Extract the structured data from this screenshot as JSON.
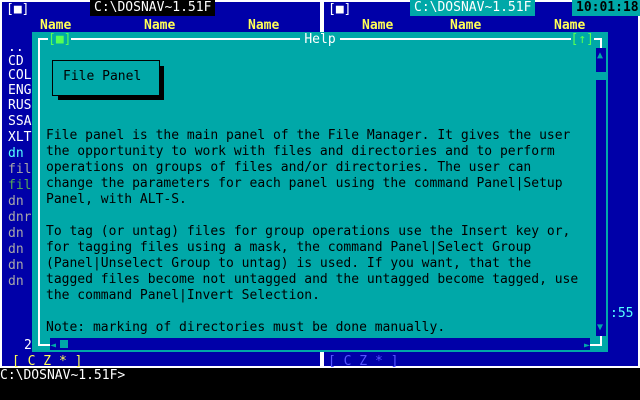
{
  "left_panel": {
    "path": "",
    "columns": [
      "Name",
      "Name",
      "Name"
    ],
    "items": [
      "..",
      "CD",
      "COL",
      "ENG",
      "RUS",
      "SSA",
      "XLT",
      "dn",
      "fil",
      "fil",
      "dn",
      "dnr",
      "dn",
      "dn",
      "dn",
      "dn"
    ],
    "drive_bar": "[ C Z * ]",
    "left_marker": "2"
  },
  "right_panel": {
    "path": "C:\\DOSNAV~1.51F",
    "columns": [
      "Name",
      "Name",
      "Name"
    ],
    "drive_bar": "[ C Z * ]",
    "edge_text": ":55"
  },
  "header": {
    "left_path": "C:\\DOSNAV~1.51F",
    "clock": "10:01:18",
    "left_close": "[■]",
    "right_close": "[■]"
  },
  "help": {
    "title": "Help",
    "close_btn": "[■]",
    "zoom_btn": "[↑]",
    "topic": "File Panel",
    "body": "File panel is the main panel of the File Manager. It gives the user\nthe opportunity to work with files and directories and to perform\noperations on groups of files and/or directories. The user can\nchange the parameters for each panel using the command Panel|Setup\nPanel, with ALT-S.\n\nTo tag (or untag) files for group operations use the Insert key or,\nfor tagging files using a mask, the command Panel|Select Group\n(Panel|Unselect Group to untag) is used. If you want, that the\ntagged files become not untagged and the untagged become tagged, use\nthe command Panel|Invert Selection.\n\nNote: marking of directories must be done manually."
  },
  "prompt": "C:\\DOSNAV~1.51F>"
}
